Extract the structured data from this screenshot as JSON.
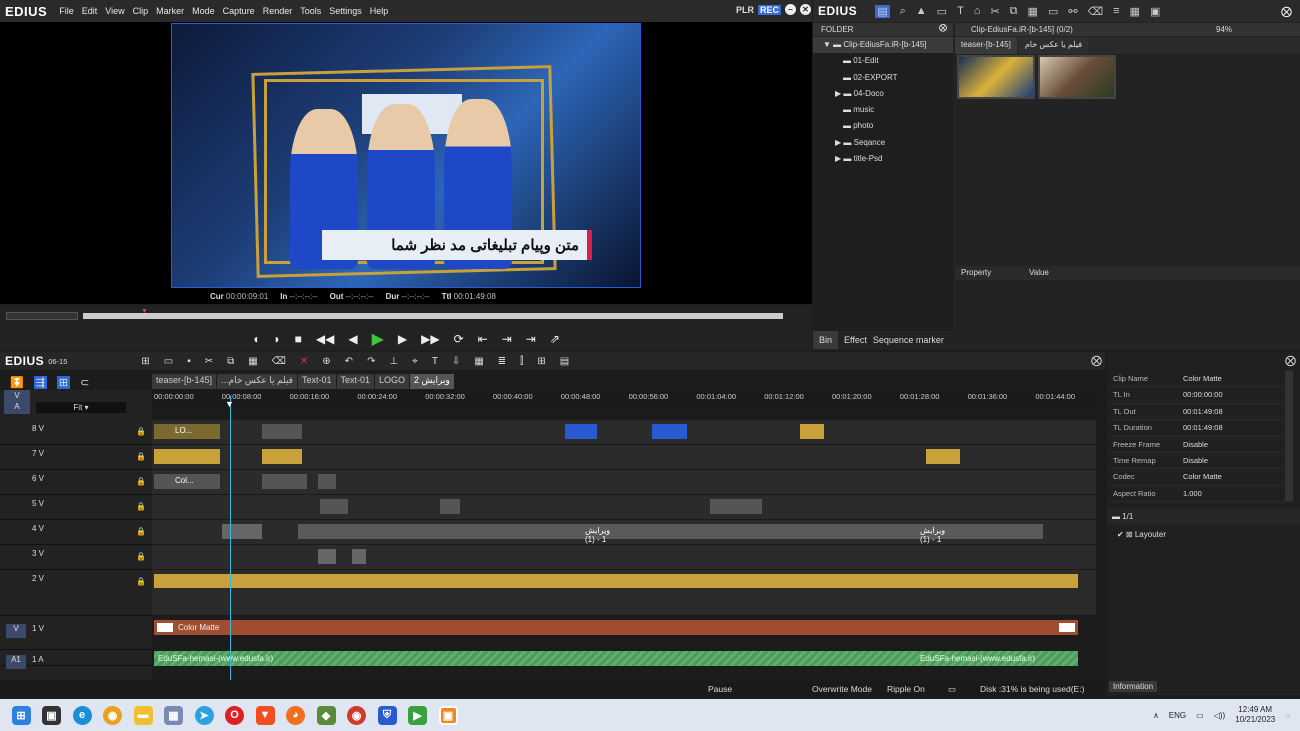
{
  "app": {
    "logo": "EDIUS",
    "menu": [
      "File",
      "Edit",
      "View",
      "Clip",
      "Marker",
      "Mode",
      "Capture",
      "Render",
      "Tools",
      "Settings",
      "Help"
    ],
    "plr": "PLR",
    "rec": "REC"
  },
  "preview": {
    "overlay_text": "متن وپیام تبلیغاتی مد نظر شما",
    "cur_label": "Cur",
    "cur_value": "00:00:09:01",
    "in_label": "In",
    "in_value": "--:--:--:--",
    "out_label": "Out",
    "out_value": "--:--:--:--",
    "dur_label": "Dur",
    "dur_value": "--:--:--:--",
    "ttl_label": "Ttl",
    "ttl_value": "00:01:49:08"
  },
  "bin": {
    "logo": "EDIUS",
    "folder_header": "FOLDER",
    "bin_title": "Clip-EdiusFa.iR-[b-145] (0/2)",
    "zoom": "94%",
    "folders": [
      {
        "label": "Clip-EdiusFa.iR-[b-145]",
        "exp": "▼"
      },
      {
        "label": "01-Edit",
        "exp": ""
      },
      {
        "label": "02-EXPORT",
        "exp": ""
      },
      {
        "label": "04-Doco",
        "exp": "▶"
      },
      {
        "label": "music",
        "exp": ""
      },
      {
        "label": "photo",
        "exp": ""
      },
      {
        "label": "Seqance",
        "exp": "▶"
      },
      {
        "label": "title-Psd",
        "exp": "▶"
      }
    ],
    "tabs": [
      "teaser-[b-145]",
      "فیلم یا عکس خام"
    ],
    "property_label": "Property",
    "value_label": "Value",
    "bottom_tabs": [
      "Bin",
      "Effect",
      "Sequence marker"
    ]
  },
  "timeline": {
    "logo": "EDIUS",
    "version": "06-15",
    "fit": "Fit",
    "seq_tabs": [
      "teaser-[b-145]",
      "...فیلم یا عکس خام",
      "Text-01",
      "Text-01",
      "LOGO",
      "ویرایش 2"
    ],
    "ruler": [
      "00:00:00:00",
      "00:00:08:00",
      "00:00:16:00",
      "00:00:24:00",
      "00:00:32:00",
      "00:00:40:00",
      "00:00:48:00",
      "00:00:56:00",
      "00:01:04:00",
      "00:01:12:00",
      "00:01:20:00",
      "00:01:28:00",
      "00:01:36:00",
      "00:01:44:00"
    ],
    "tracks": [
      "8 V",
      "7 V",
      "6 V",
      "5 V",
      "4 V",
      "3 V",
      "2 V"
    ],
    "track_1v": "1 V",
    "track_a1": "1 A",
    "va_v": "V",
    "va_a": "A",
    "v_label": "V",
    "a1_label": "A1",
    "clip_logo": "LO...",
    "clip_col": "Col...",
    "clip_edit1": "ویرایش 1 - (1)",
    "clip_edit2": "ویرایش 1 - (1)",
    "color_matte": "Color Matte",
    "audio_clip": "EduSFa-hemasi-(www.edusfa.ir)",
    "audio_clip2": "EduSFa-hemasi-(www.edusfa.ir)"
  },
  "status": {
    "pause": "Pause",
    "mode": "Overwrite Mode",
    "ripple": "Ripple On",
    "disk": "Disk :31% is being used(E:)"
  },
  "info": {
    "rows": [
      {
        "k": "Clip Name",
        "v": "Color Matte"
      },
      {
        "k": "TL In",
        "v": "00:00:00:00"
      },
      {
        "k": "TL Out",
        "v": "00:01:49:08"
      },
      {
        "k": "TL Duration",
        "v": "00:01:49:08"
      },
      {
        "k": "Freeze Frame",
        "v": "Disable"
      },
      {
        "k": "Time Remap",
        "v": "Disable"
      },
      {
        "k": "Codec",
        "v": "Color Matte"
      },
      {
        "k": "Aspect Ratio",
        "v": "1.000"
      }
    ],
    "page": "1/1",
    "layouter": "Layouter",
    "tab": "Information"
  },
  "taskbar": {
    "lang": "ENG",
    "time": "12:49 AM",
    "date": "10/21/2023"
  }
}
